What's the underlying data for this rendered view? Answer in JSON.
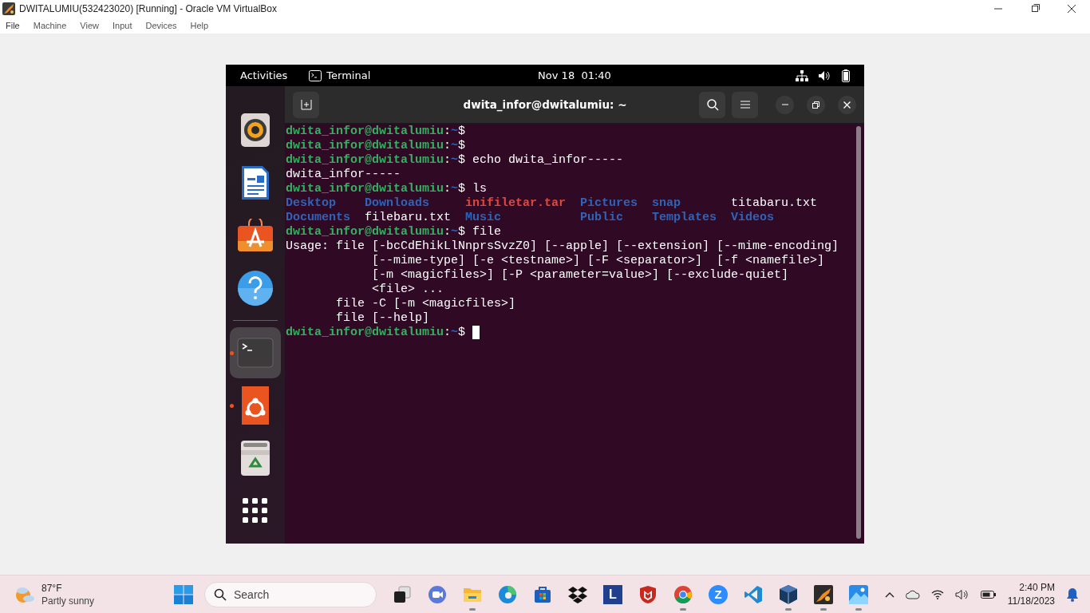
{
  "window": {
    "title": "DWITALUMIU(532423020) [Running] - Oracle VM VirtualBox"
  },
  "menu": [
    "File",
    "Machine",
    "View",
    "Input",
    "Devices",
    "Help"
  ],
  "top_bar": {
    "activities": "Activities",
    "app": "Terminal",
    "clock": "Nov 18  01:40"
  },
  "dock": [
    {
      "kind": "speaker",
      "running": false,
      "selected": false,
      "separator_before": false
    },
    {
      "kind": "writer",
      "running": false,
      "selected": false,
      "separator_before": false
    },
    {
      "kind": "software",
      "running": false,
      "selected": false,
      "separator_before": false
    },
    {
      "kind": "help",
      "running": false,
      "selected": false,
      "separator_before": false
    },
    {
      "kind": "terminal",
      "running": true,
      "selected": true,
      "separator_before": true
    },
    {
      "kind": "ubuntu",
      "running": true,
      "selected": false,
      "separator_before": false
    },
    {
      "kind": "trash",
      "running": false,
      "selected": false,
      "separator_before": false
    },
    {
      "kind": "apps",
      "running": false,
      "selected": false,
      "separator_before": false
    }
  ],
  "terminal": {
    "title": "dwita_infor@dwitalumiu: ~",
    "lines": [
      {
        "kind": "prompt",
        "cursor": false,
        "segments": [
          {
            "kind": "user",
            "text": "dwita_infor@dwitalumiu"
          },
          {
            "kind": "plain",
            "text": ":"
          },
          {
            "kind": "path",
            "text": "~"
          },
          {
            "kind": "plain",
            "text": "$"
          }
        ]
      },
      {
        "kind": "prompt",
        "cursor": false,
        "segments": [
          {
            "kind": "user",
            "text": "dwita_infor@dwitalumiu"
          },
          {
            "kind": "plain",
            "text": ":"
          },
          {
            "kind": "path",
            "text": "~"
          },
          {
            "kind": "plain",
            "text": "$"
          }
        ]
      },
      {
        "kind": "prompt",
        "cursor": false,
        "segments": [
          {
            "kind": "user",
            "text": "dwita_infor@dwitalumiu"
          },
          {
            "kind": "plain",
            "text": ":"
          },
          {
            "kind": "path",
            "text": "~"
          },
          {
            "kind": "plain",
            "text": "$ echo dwita_infor-----"
          }
        ]
      },
      {
        "kind": "output",
        "text": "dwita_infor-----"
      },
      {
        "kind": "prompt",
        "cursor": false,
        "segments": [
          {
            "kind": "user",
            "text": "dwita_infor@dwitalumiu"
          },
          {
            "kind": "plain",
            "text": ":"
          },
          {
            "kind": "path",
            "text": "~"
          },
          {
            "kind": "plain",
            "text": "$ ls"
          }
        ]
      },
      {
        "kind": "listing",
        "entries": [
          {
            "name": "Desktop",
            "kind": "dir"
          },
          {
            "name": "Downloads",
            "kind": "dir"
          },
          {
            "name": "inifiletar.tar",
            "kind": "archive"
          },
          {
            "name": "Pictures",
            "kind": "dir"
          },
          {
            "name": "snap",
            "kind": "dir"
          },
          {
            "name": "titabaru.txt",
            "kind": "file"
          }
        ]
      },
      {
        "kind": "listing",
        "entries": [
          {
            "name": "Documents",
            "kind": "dir"
          },
          {
            "name": "filebaru.txt",
            "kind": "file"
          },
          {
            "name": "Music",
            "kind": "dir"
          },
          {
            "name": "Public",
            "kind": "dir"
          },
          {
            "name": "Templates",
            "kind": "dir"
          },
          {
            "name": "Videos",
            "kind": "dir"
          }
        ]
      },
      {
        "kind": "prompt",
        "cursor": false,
        "segments": [
          {
            "kind": "user",
            "text": "dwita_infor@dwitalumiu"
          },
          {
            "kind": "plain",
            "text": ":"
          },
          {
            "kind": "path",
            "text": "~"
          },
          {
            "kind": "plain",
            "text": "$ file"
          }
        ]
      },
      {
        "kind": "output",
        "text": "Usage: file [-bcCdEhikLlNnprsSvzZ0] [--apple] [--extension] [--mime-encoding]"
      },
      {
        "kind": "output",
        "text": "            [--mime-type] [-e <testname>] [-F <separator>]  [-f <namefile>]"
      },
      {
        "kind": "output",
        "text": "            [-m <magicfiles>] [-P <parameter=value>] [--exclude-quiet]"
      },
      {
        "kind": "output",
        "text": "            <file> ..."
      },
      {
        "kind": "output",
        "text": "       file -C [-m <magicfiles>]"
      },
      {
        "kind": "output",
        "text": "       file [--help]"
      },
      {
        "kind": "prompt",
        "cursor": true,
        "segments": [
          {
            "kind": "user",
            "text": "dwita_infor@dwitalumiu"
          },
          {
            "kind": "plain",
            "text": ":"
          },
          {
            "kind": "path",
            "text": "~"
          },
          {
            "kind": "plain",
            "text": "$"
          }
        ]
      }
    ]
  },
  "taskbar": {
    "weather": {
      "temp": "87°F",
      "condition": "Partly sunny"
    },
    "search": {
      "placeholder": "Search"
    },
    "apps": [
      {
        "kind": "taskview",
        "running": false
      },
      {
        "kind": "meet",
        "running": false
      },
      {
        "kind": "explorer",
        "running": true
      },
      {
        "kind": "edge",
        "running": false
      },
      {
        "kind": "store",
        "running": false
      },
      {
        "kind": "dropbox",
        "running": false
      },
      {
        "kind": "letter",
        "label": "L",
        "running": false
      },
      {
        "kind": "shield",
        "running": false
      },
      {
        "kind": "chrome",
        "running": true
      },
      {
        "kind": "zoom",
        "label": "Z",
        "running": false
      },
      {
        "kind": "vscode",
        "running": false
      },
      {
        "kind": "virtualbox",
        "running": true
      },
      {
        "kind": "vm",
        "running": true
      },
      {
        "kind": "photos",
        "running": true
      }
    ],
    "time": "2:40 PM",
    "date": "11/18/2023"
  }
}
